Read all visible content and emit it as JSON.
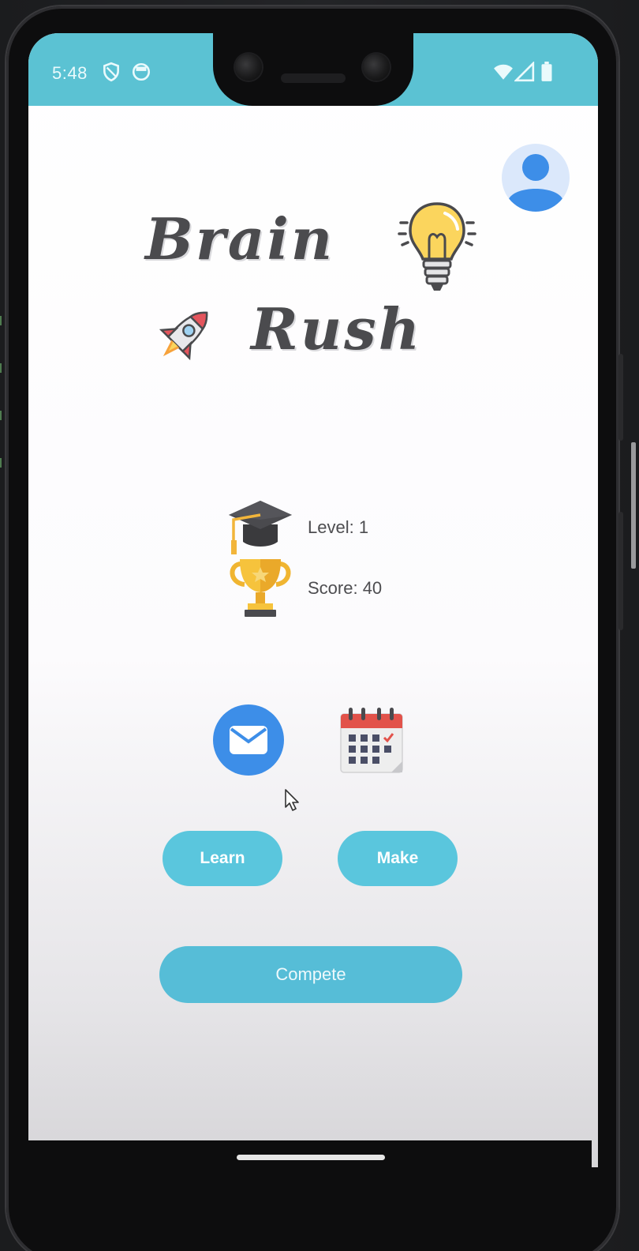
{
  "status_bar": {
    "time": "5:48",
    "left_icons": [
      "shield-icon",
      "circle-storage-icon"
    ],
    "right_icons": [
      "wifi-icon",
      "cell-signal-icon",
      "battery-icon"
    ],
    "color": "#5bc2d3"
  },
  "app": {
    "title_line1": "Brain",
    "title_line2": "Rush",
    "title_icons": [
      "lightbulb-icon",
      "rocket-icon"
    ],
    "profile_icon": "account-avatar-icon"
  },
  "stats": {
    "level_label": "Level: 1",
    "score_label": "Score: 40",
    "level_icon": "graduation-cap-icon",
    "score_icon": "trophy-icon"
  },
  "actions": {
    "mail_icon": "mail-icon",
    "calendar_icon": "calendar-icon",
    "learn_label": "Learn",
    "make_label": "Make",
    "compete_label": "Compete",
    "accent_color": "#5ac6dd",
    "mail_color": "#3d8ee8"
  }
}
